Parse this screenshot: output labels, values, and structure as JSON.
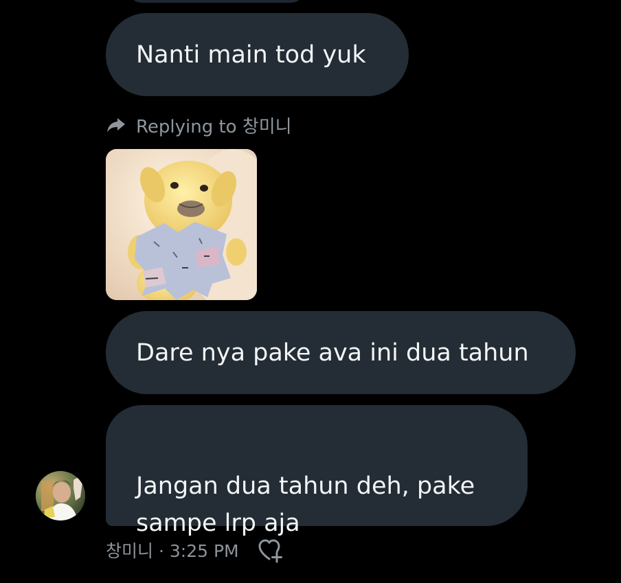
{
  "messages": [
    {
      "text": "Nanti main tod yuk"
    },
    {
      "text": "Dare nya pake ava ini dua tahun"
    },
    {
      "text": "Jangan dua tahun deh, pake\nsampe lrp aja"
    }
  ],
  "reply": {
    "label": "Replying to 창미니",
    "icon": "reply-arrow-icon"
  },
  "image": {
    "icon": "plush-toy-photo"
  },
  "sender": {
    "name": "창미니",
    "time": "3:25 PM",
    "separator": "·"
  },
  "icons": {
    "avatar": "avatar",
    "react": "heart-plus-icon"
  },
  "colors": {
    "background": "#000000",
    "bubble": "#242d35",
    "text": "#f3f5f7",
    "muted": "#8f979e"
  }
}
